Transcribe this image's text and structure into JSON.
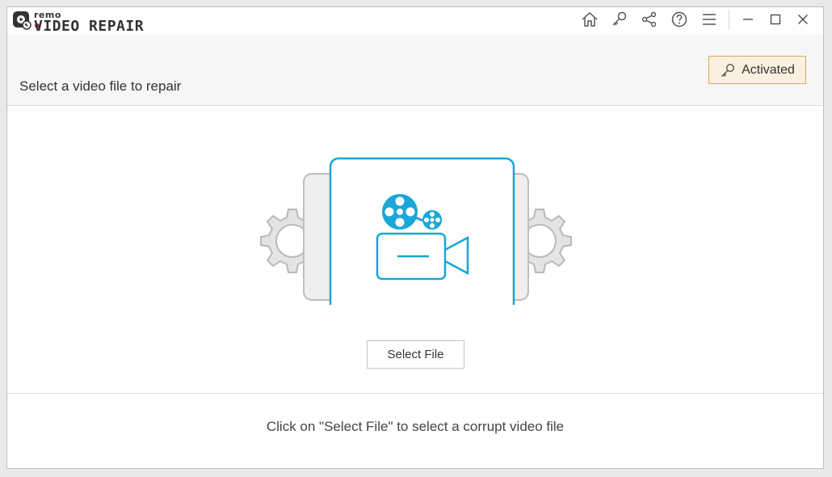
{
  "app": {
    "brand_small": "remo",
    "brand_title": "VIDEO REPAIR"
  },
  "toolbar": {
    "icons": [
      "home-icon",
      "key-icon",
      "share-icon",
      "help-icon",
      "menu-icon"
    ],
    "window_controls": [
      "minimize-icon",
      "maximize-icon",
      "close-icon"
    ]
  },
  "header": {
    "title": "Select a video file to repair",
    "activated_label": "Activated"
  },
  "main": {
    "select_file_label": "Select File",
    "illustration_icon": "video-camera-film-reel-icon",
    "accent_color": "#1aa6d8"
  },
  "footer": {
    "hint": "Click on \"Select File\" to select a corrupt video file"
  }
}
